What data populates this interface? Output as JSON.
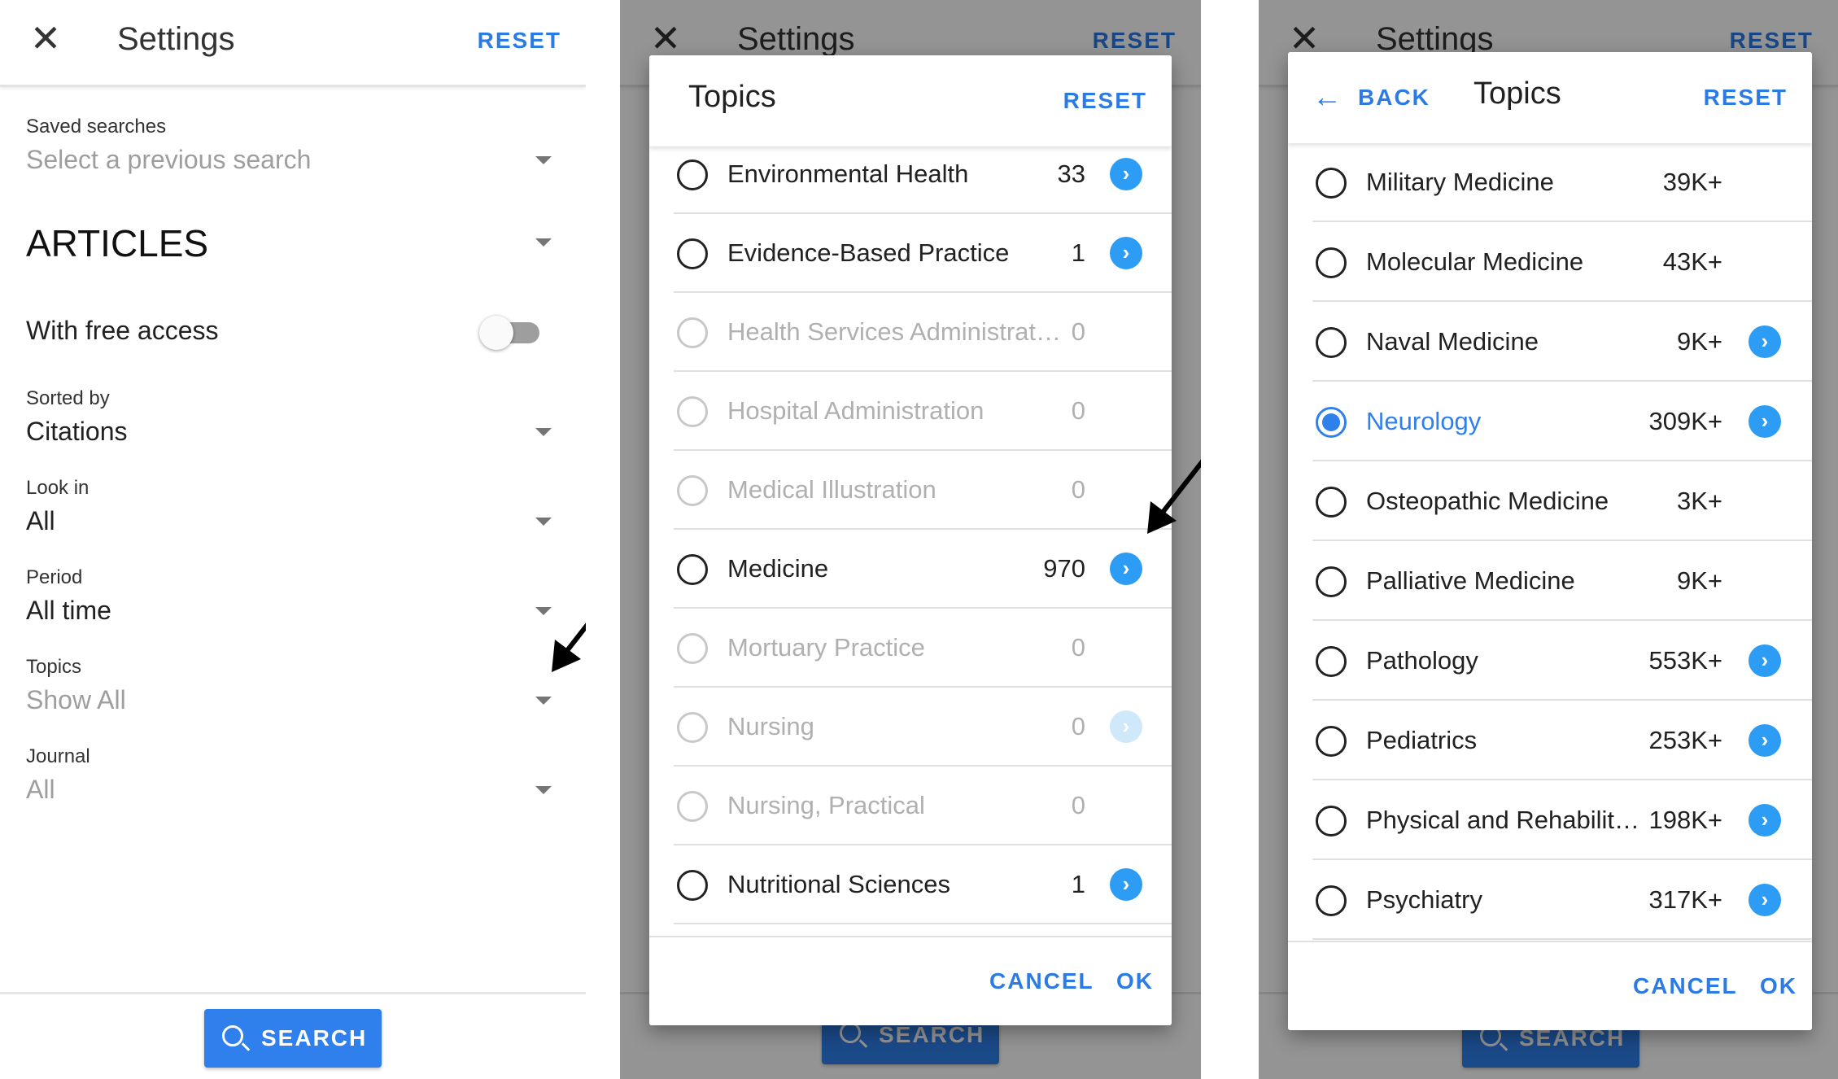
{
  "settings": {
    "title": "Settings",
    "reset_label": "RESET",
    "saved_searches": {
      "label": "Saved searches",
      "placeholder": "Select a previous search"
    },
    "section": "ARTICLES",
    "free_access_label": "With free access",
    "sorted_by": {
      "label": "Sorted by",
      "value": "Citations"
    },
    "look_in": {
      "label": "Look in",
      "value": "All"
    },
    "period": {
      "label": "Period",
      "value": "All time"
    },
    "topics": {
      "label": "Topics",
      "value": "Show All"
    },
    "journal": {
      "label": "Journal",
      "value": "All"
    },
    "search_label": "SEARCH"
  },
  "dialog1": {
    "title": "Topics",
    "reset_label": "RESET",
    "rows": [
      {
        "label": "Environmental Health",
        "count": "33",
        "disabled": false
      },
      {
        "label": "Evidence-Based Practice",
        "count": "1",
        "disabled": false
      },
      {
        "label": "Health Services Administrat…",
        "count": "0",
        "disabled": true
      },
      {
        "label": "Hospital Administration",
        "count": "0",
        "disabled": true
      },
      {
        "label": "Medical Illustration",
        "count": "0",
        "disabled": true
      },
      {
        "label": "Medicine",
        "count": "970",
        "disabled": false
      },
      {
        "label": "Mortuary Practice",
        "count": "0",
        "disabled": true
      },
      {
        "label": "Nursing",
        "count": "0",
        "disabled": true
      },
      {
        "label": "Nursing, Practical",
        "count": "0",
        "disabled": true
      },
      {
        "label": "Nutritional Sciences",
        "count": "1",
        "disabled": false
      }
    ],
    "cancel_label": "CANCEL",
    "ok_label": "OK"
  },
  "dialog2": {
    "back_label": "BACK",
    "title": "Topics",
    "reset_label": "RESET",
    "rows": [
      {
        "label": "Military Medicine",
        "count": "39K+",
        "selected": false
      },
      {
        "label": "Molecular Medicine",
        "count": "43K+",
        "selected": false
      },
      {
        "label": "Naval Medicine",
        "count": "9K+",
        "selected": false
      },
      {
        "label": "Neurology",
        "count": "309K+",
        "selected": true
      },
      {
        "label": "Osteopathic Medicine",
        "count": "3K+",
        "selected": false
      },
      {
        "label": "Palliative Medicine",
        "count": "9K+",
        "selected": false
      },
      {
        "label": "Pathology",
        "count": "553K+",
        "selected": false
      },
      {
        "label": "Pediatrics",
        "count": "253K+",
        "selected": false
      },
      {
        "label": "Physical and Rehabilit…",
        "count": "198K+",
        "selected": false
      },
      {
        "label": "Psychiatry",
        "count": "317K+",
        "selected": false
      }
    ],
    "cancel_label": "CANCEL",
    "ok_label": "OK"
  },
  "icons": {
    "close": "close-icon",
    "back": "back-arrow-icon",
    "search": "search-icon",
    "chevron": "chevron-right-icon",
    "dropdown": "dropdown-caret-icon"
  },
  "colors": {
    "accent": "#2f80ed",
    "link": "#2c7be5",
    "chevron": "#2d9cf5",
    "disabled": "#b0b0b0"
  }
}
